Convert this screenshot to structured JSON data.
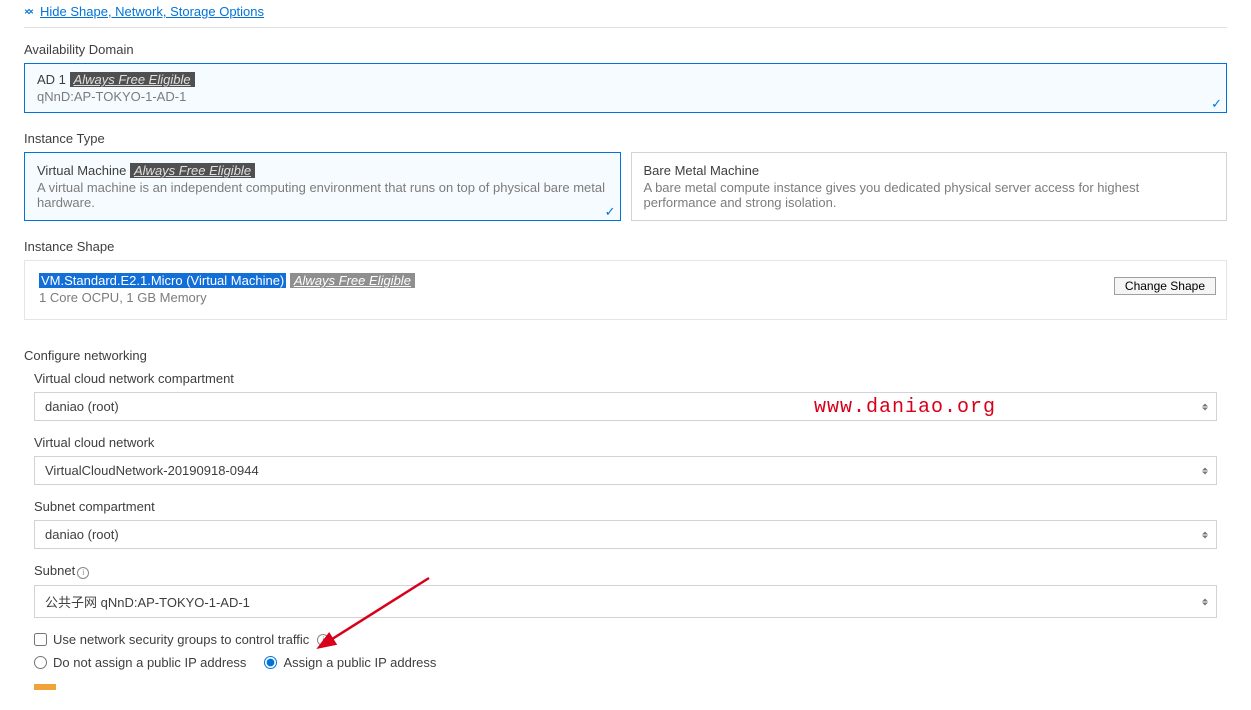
{
  "toggle": {
    "label": "Hide Shape, Network, Storage Options"
  },
  "availability_domain": {
    "section_label": "Availability Domain",
    "title_prefix": "AD 1",
    "badge": "Always Free Eligible",
    "sub": "qNnD:AP-TOKYO-1-AD-1"
  },
  "instance_type": {
    "section_label": "Instance Type",
    "options": [
      {
        "title": "Virtual Machine",
        "badge": "Always Free Eligible",
        "desc": "A virtual machine is an independent computing environment that runs on top of physical bare metal hardware.",
        "selected": true
      },
      {
        "title": "Bare Metal Machine",
        "badge": "",
        "desc": "A bare metal compute instance gives you dedicated physical server access for highest performance and strong isolation.",
        "selected": false
      }
    ]
  },
  "instance_shape": {
    "section_label": "Instance Shape",
    "shape_name": "VM.Standard.E2.1.Micro (Virtual Machine)",
    "badge": "Always Free Eligible",
    "spec": "1 Core OCPU, 1 GB Memory",
    "change_button": "Change Shape"
  },
  "networking": {
    "section_label": "Configure networking",
    "vcn_compartment": {
      "label": "Virtual cloud network compartment",
      "value": "daniao (root)"
    },
    "vcn": {
      "label": "Virtual cloud network",
      "value": "VirtualCloudNetwork-20190918-0944"
    },
    "subnet_compartment": {
      "label": "Subnet compartment",
      "value": "daniao (root)"
    },
    "subnet": {
      "label": "Subnet",
      "value": "公共子网 qNnD:AP-TOKYO-1-AD-1"
    },
    "nsg_checkbox": {
      "label": "Use network security groups to control traffic",
      "checked": false
    },
    "public_ip": {
      "option_no": "Do not assign a public IP address",
      "option_yes": "Assign a public IP address",
      "selected": "yes"
    }
  },
  "watermark": "www.daniao.org"
}
